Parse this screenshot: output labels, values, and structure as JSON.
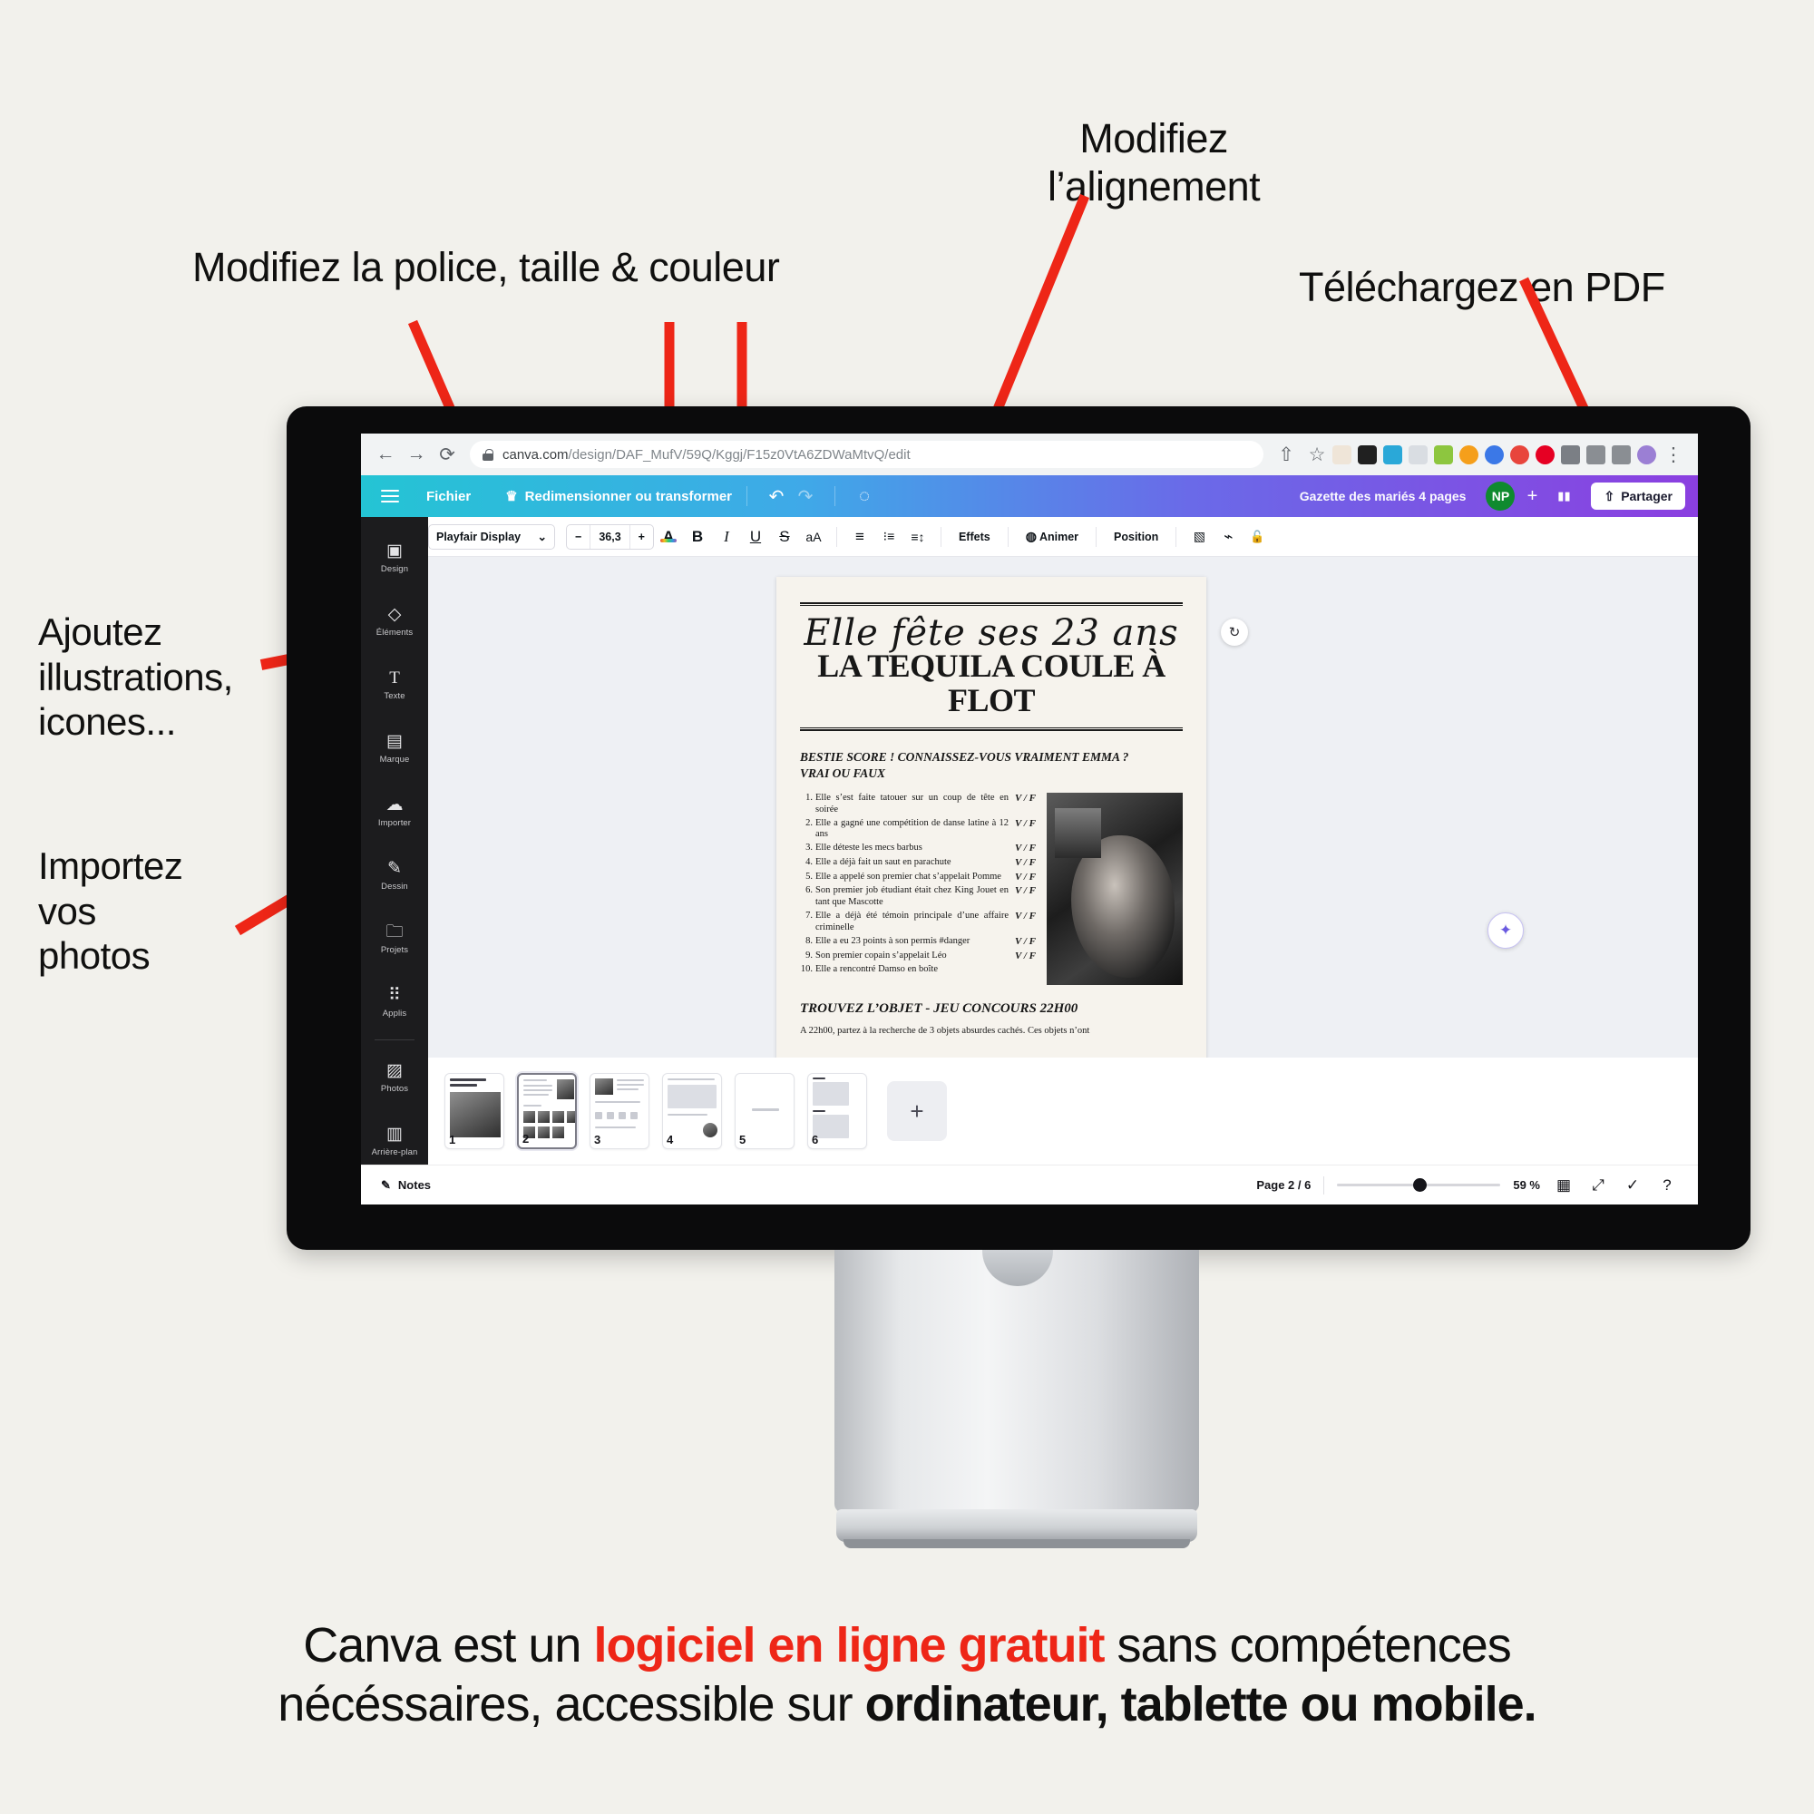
{
  "callouts": {
    "font": "Modifiez la police, taille & couleur",
    "align": "Modifiez\nl’alignement",
    "pdf": "Téléchargez en PDF",
    "elements": "Ajoutez\nillustrations,\nicones...",
    "import": "Importez\nvos\nphotos"
  },
  "browser": {
    "back_icon": "←",
    "forward_icon": "→",
    "reload_icon": "⟳",
    "url_main": "canva.com",
    "url_rest": "/design/DAF_MufV/59Q/Kggj/F15z0VtA6ZDWaMtvQ/edit",
    "share_icon": "⇧",
    "bookmark_icon": "☆",
    "menu_icon": "⋮",
    "extensions": [
      {
        "name": "pipette-extension-icon",
        "color": "#efe5d8"
      },
      {
        "name": "fj-extension-icon",
        "color": "#202020"
      },
      {
        "name": "on-extension-icon",
        "color": "#2aa8d8"
      },
      {
        "name": "grid-extension-icon",
        "color": "#d9dde2"
      },
      {
        "name": "green-extension-icon",
        "color": "#8dc63f"
      },
      {
        "name": "yin-yang-extension-icon",
        "color": "#f59f1b"
      },
      {
        "name": "flower-extension-icon",
        "color": "#3b78e7"
      },
      {
        "name": "red-circle-extension-icon",
        "color": "#e8453c"
      },
      {
        "name": "pinterest-extension-icon",
        "color": "#e60023"
      },
      {
        "name": "puzzle-extension-icon",
        "color": "#5f6368"
      },
      {
        "name": "download-extension-icon",
        "color": "#5f6368"
      },
      {
        "name": "sidepanel-extension-icon",
        "color": "#5f6368"
      },
      {
        "name": "profile-avatar-icon",
        "color": "#9b7fd4"
      }
    ]
  },
  "canva_top": {
    "menu_file": "Fichier",
    "resize": "Redimensionner ou transformer",
    "crown_icon": "♛",
    "undo_icon": "↶",
    "redo_icon": "↷",
    "cloud_icon": "◌",
    "doc_title": "Gazette des mariés 4 pages",
    "avatar_initials": "NP",
    "invite_plus": "+",
    "insights_icon": "▮▮",
    "share_label": "Partager",
    "share_icon": "⇧"
  },
  "toolbar": {
    "font_name": "Playfair Display",
    "chevron": "⌄",
    "minus": "−",
    "font_size": "36,3",
    "plus": "+",
    "text_color_icon": "A",
    "bold": "B",
    "italic": "I",
    "underline": "U",
    "strike": "S",
    "case": "aA",
    "align_icon": "≡",
    "list_icon": "⁝≡",
    "spacing_icon": "≡↕",
    "effects": "Effets",
    "animate": "Animer",
    "position": "Position",
    "transparency_icon": "▧",
    "copy_style_icon": "⌁",
    "lock_icon": "🔓"
  },
  "sidebar": {
    "items": [
      {
        "label": "Design",
        "icon": "▣"
      },
      {
        "label": "Éléments",
        "icon": "◇"
      },
      {
        "label": "Texte",
        "icon": "T"
      },
      {
        "label": "Marque",
        "icon": "▤"
      },
      {
        "label": "Importer",
        "icon": "☁"
      },
      {
        "label": "Dessin",
        "icon": "✎"
      },
      {
        "label": "Projets",
        "icon": "🗀"
      },
      {
        "label": "Applis",
        "icon": "⠿"
      },
      {
        "label": "Photos",
        "icon": "▨"
      },
      {
        "label": "Arrière-plan",
        "icon": "▥"
      }
    ]
  },
  "document": {
    "script_title": "Elle fête ses 23 ans",
    "headline": "LA TEQUILA COULE À FLOT",
    "subheading": "BESTIE SCORE ! CONNAISSEZ-VOUS VRAIMENT EMMA ?\nVRAI OU FAUX",
    "quiz": [
      {
        "n": "1.",
        "text": "Elle s’est faite tatouer sur un coup de tête en soirée",
        "vf": "V / F"
      },
      {
        "n": "2.",
        "text": "Elle a gagné une compétition de danse latine à 12 ans",
        "vf": "V / F"
      },
      {
        "n": "3.",
        "text": "Elle déteste les mecs barbus",
        "vf": "V / F"
      },
      {
        "n": "4.",
        "text": "Elle a déjà fait un saut en parachute",
        "vf": "V / F"
      },
      {
        "n": "5.",
        "text": "Elle a appelé son premier chat s’appelait Pomme",
        "vf": "V / F"
      },
      {
        "n": "6.",
        "text": "Son premier job étudiant était chez King Jouet en tant que Mascotte",
        "vf": "V / F"
      },
      {
        "n": "7.",
        "text": "Elle a déjà été témoin principale d’une affaire criminelle",
        "vf": "V / F"
      },
      {
        "n": "8.",
        "text": "Elle a eu 23 points à son permis #danger",
        "vf": "V / F"
      },
      {
        "n": "9.",
        "text": "Son premier copain s’appelait Léo",
        "vf": "V / F"
      },
      {
        "n": "10.",
        "text": "Elle a rencontré Damso en boîte",
        "vf": ""
      }
    ],
    "section2_title": "TROUVEZ L’OBJET - JEU CONCOURS 22H00",
    "section2_body": "A 22h00, partez à la recherche de 3 objets absurdes cachés. Ces objets n’ont"
  },
  "canvas": {
    "rotate_icon": "↻",
    "magic_icon": "✦"
  },
  "thumbnails": [
    {
      "num": "1"
    },
    {
      "num": "2"
    },
    {
      "num": "3"
    },
    {
      "num": "4"
    },
    {
      "num": "5"
    },
    {
      "num": "6"
    }
  ],
  "thumb_add": "+",
  "status": {
    "notes_label": "Notes",
    "notes_icon": "✎",
    "page_count": "Page 2 / 6",
    "zoom_pct": "59 %",
    "grid_icon": "▦",
    "expand_icon": "⤢",
    "check_icon": "✓",
    "help_icon": "?"
  },
  "caption": {
    "part1": "Canva est un ",
    "highlight": "logiciel en ligne gratuit",
    "part2": " sans compétences",
    "part3": "nécéssaires, accessible sur ",
    "bold": "ordinateur, tablette ou mobile."
  },
  "colors": {
    "background": "#f2f1ec",
    "arrow_red": "#ee2617",
    "highlight_red": "#ee2617",
    "avatar_green": "#0f8a2e"
  }
}
